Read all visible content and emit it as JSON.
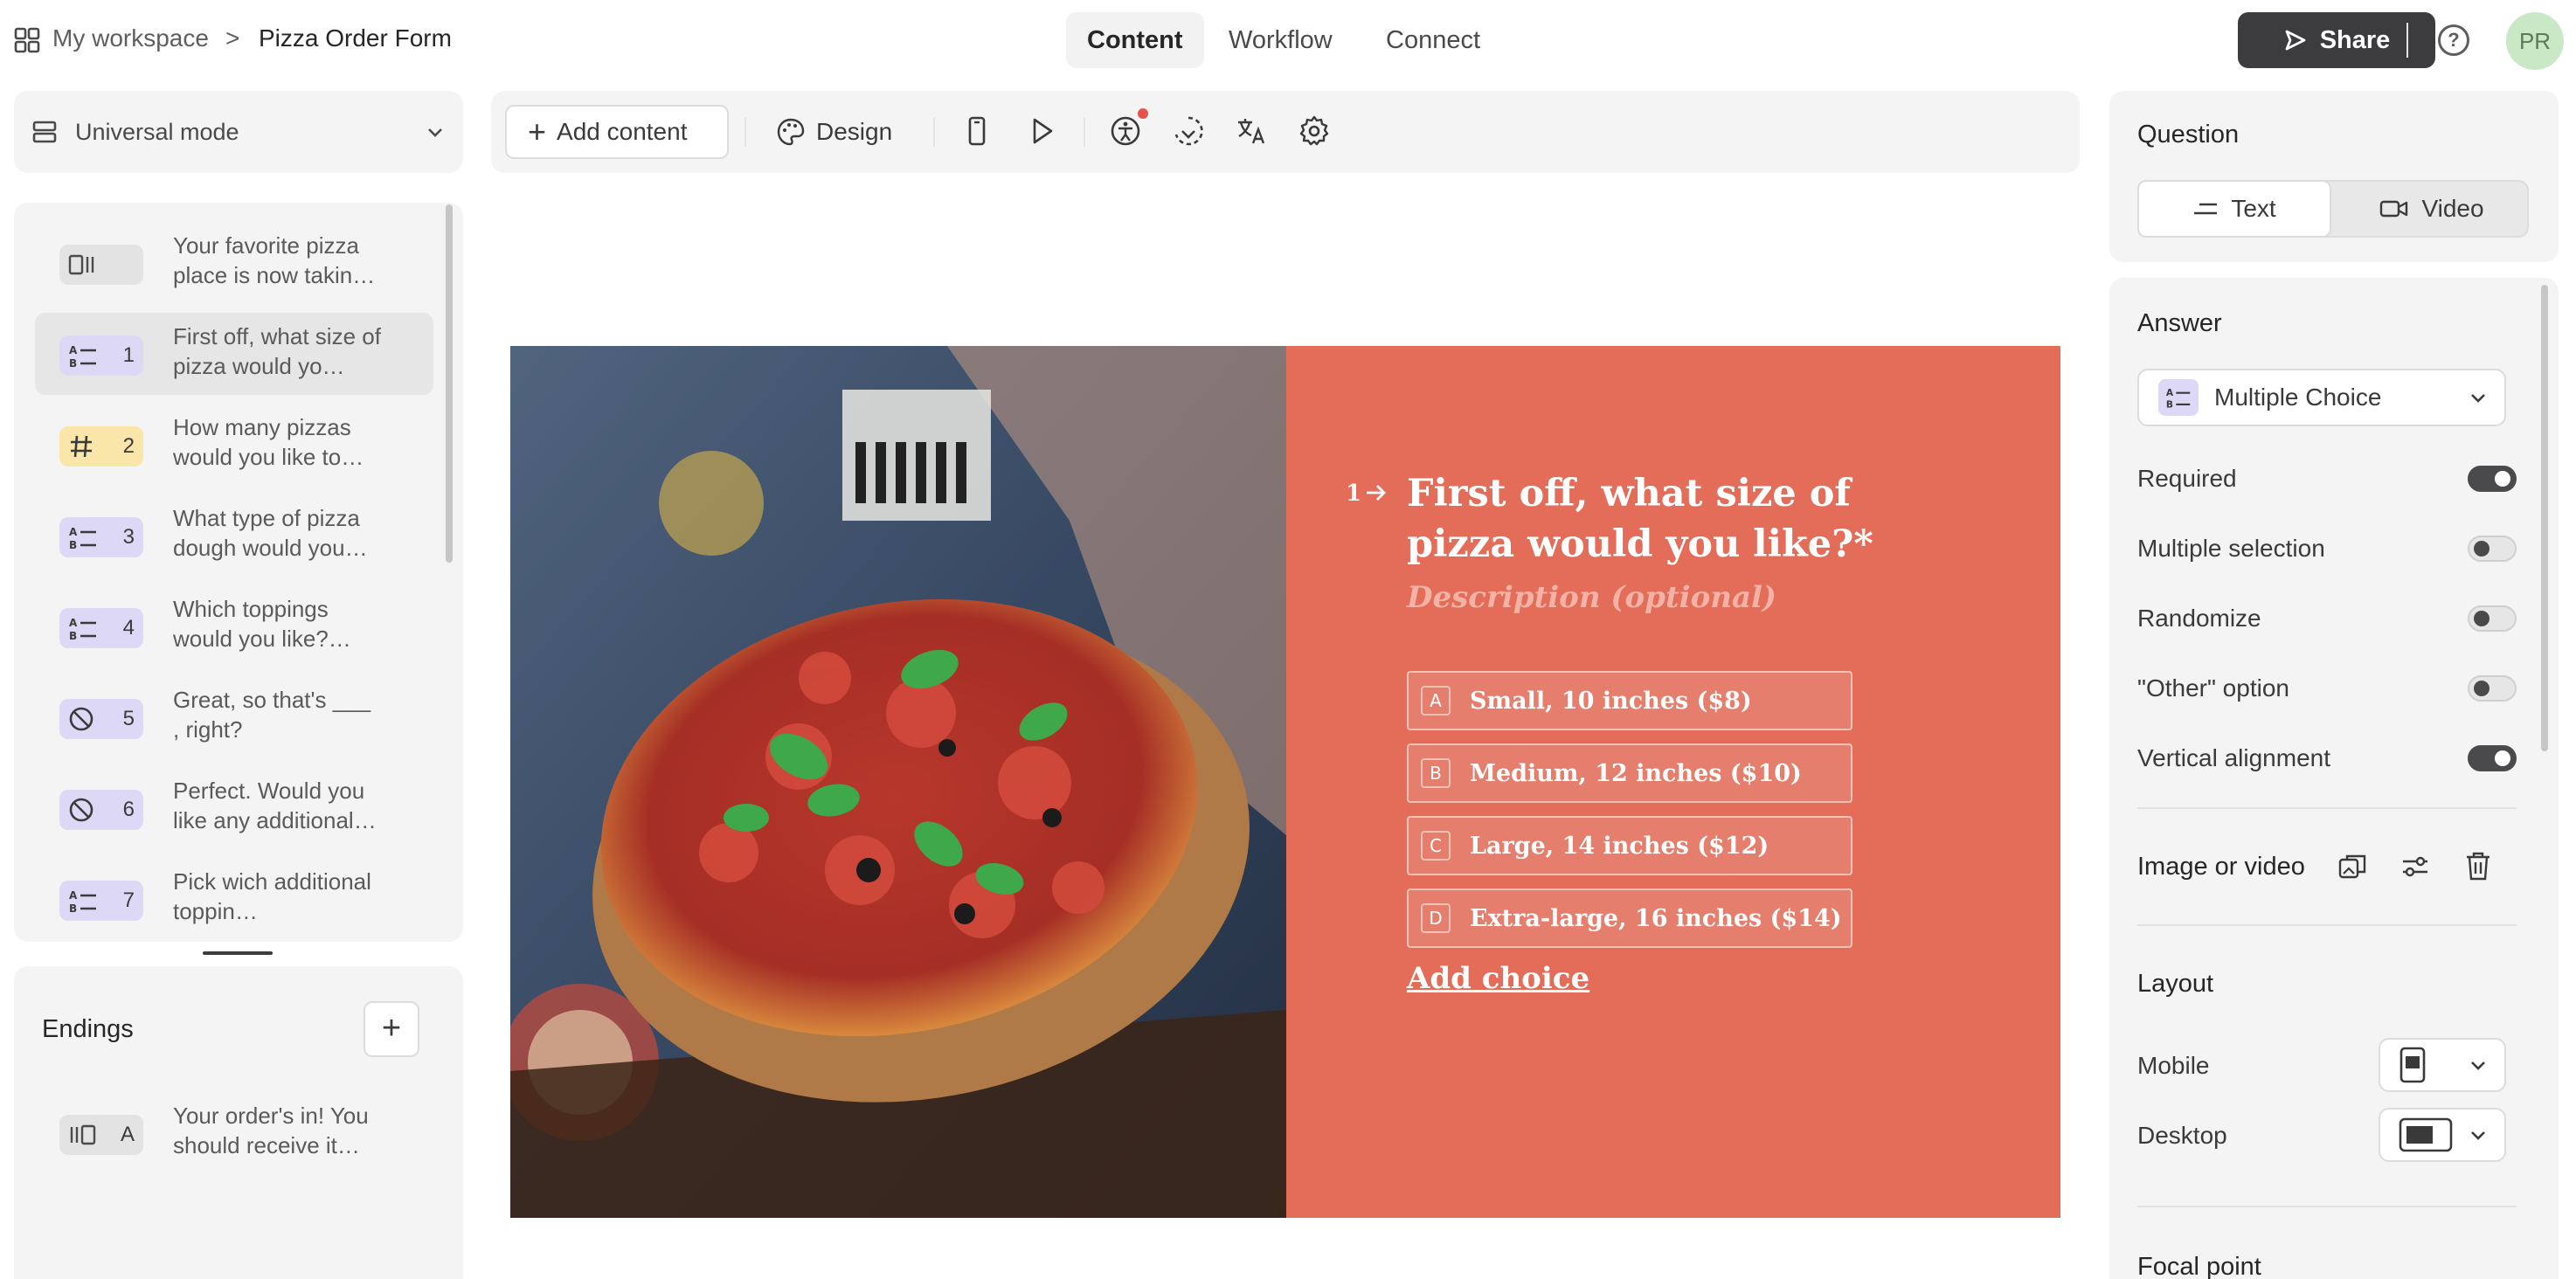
{
  "topbar": {
    "workspace": "My workspace",
    "separator": ">",
    "form_title": "Pizza Order Form",
    "tabs": [
      {
        "label": "Content",
        "active": true
      },
      {
        "label": "Workflow",
        "active": false
      },
      {
        "label": "Connect",
        "active": false
      }
    ],
    "share_label": "Share",
    "avatar_initials": "PR"
  },
  "left_panel": {
    "mode_label": "Universal mode",
    "questions": [
      {
        "number": "",
        "icon": "welcome-screen-icon",
        "badge_color": "#e3e3e3",
        "text": "Your favorite pizza place is now takin…"
      },
      {
        "number": "1",
        "icon": "multiple-choice-icon",
        "badge_color": "#dcd8f5",
        "text": "First off, what size of pizza would yo…",
        "selected": true
      },
      {
        "number": "2",
        "icon": "hash-icon",
        "badge_color": "#fae6a8",
        "text": "How many pizzas would you like to…"
      },
      {
        "number": "3",
        "icon": "multiple-choice-icon",
        "badge_color": "#dcd8f5",
        "text": "What type of pizza dough would you…"
      },
      {
        "number": "4",
        "icon": "multiple-choice-icon",
        "badge_color": "#dcd8f5",
        "text": "Which toppings would you like?…"
      },
      {
        "number": "5",
        "icon": "statement-icon",
        "badge_color": "#dcd8f5",
        "text": "Great, so that's ___ , right?"
      },
      {
        "number": "6",
        "icon": "statement-icon",
        "badge_color": "#dcd8f5",
        "text": "Perfect. Would you like any additional…"
      },
      {
        "number": "7",
        "icon": "multiple-choice-icon",
        "badge_color": "#dcd8f5",
        "text": "Pick wich additional toppin…"
      }
    ],
    "endings_title": "Endings",
    "endings": [
      {
        "number": "A",
        "icon": "ending-screen-icon",
        "text": "Your order's in! You should receive it…"
      }
    ]
  },
  "toolbar": {
    "add_content_label": "Add content",
    "design_label": "Design"
  },
  "canvas": {
    "question_number": "1",
    "question_title": "First off, what size of pizza would you like?*",
    "description_placeholder": "Description (optional)",
    "choices": [
      {
        "key": "A",
        "label": "Small, 10 inches ($8)"
      },
      {
        "key": "B",
        "label": "Medium, 12 inches ($10)"
      },
      {
        "key": "C",
        "label": "Large, 14 inches ($12)"
      },
      {
        "key": "D",
        "label": "Extra-large, 16 inches ($14)"
      }
    ],
    "add_choice_label": "Add choice",
    "accent_color": "#e36d59"
  },
  "right_panel": {
    "question_heading": "Question",
    "question_type_options": [
      {
        "label": "Text",
        "active": true
      },
      {
        "label": "Video",
        "active": false
      }
    ],
    "answer_heading": "Answer",
    "answer_type": "Multiple Choice",
    "settings": [
      {
        "label": "Required",
        "on": true
      },
      {
        "label": "Multiple selection",
        "on": false
      },
      {
        "label": "Randomize",
        "on": false
      },
      {
        "label": "\"Other\" option",
        "on": false
      },
      {
        "label": "Vertical alignment",
        "on": true
      }
    ],
    "image_video_label": "Image or video",
    "layout_heading": "Layout",
    "layout_mobile_label": "Mobile",
    "layout_desktop_label": "Desktop",
    "focal_point_heading": "Focal point"
  }
}
